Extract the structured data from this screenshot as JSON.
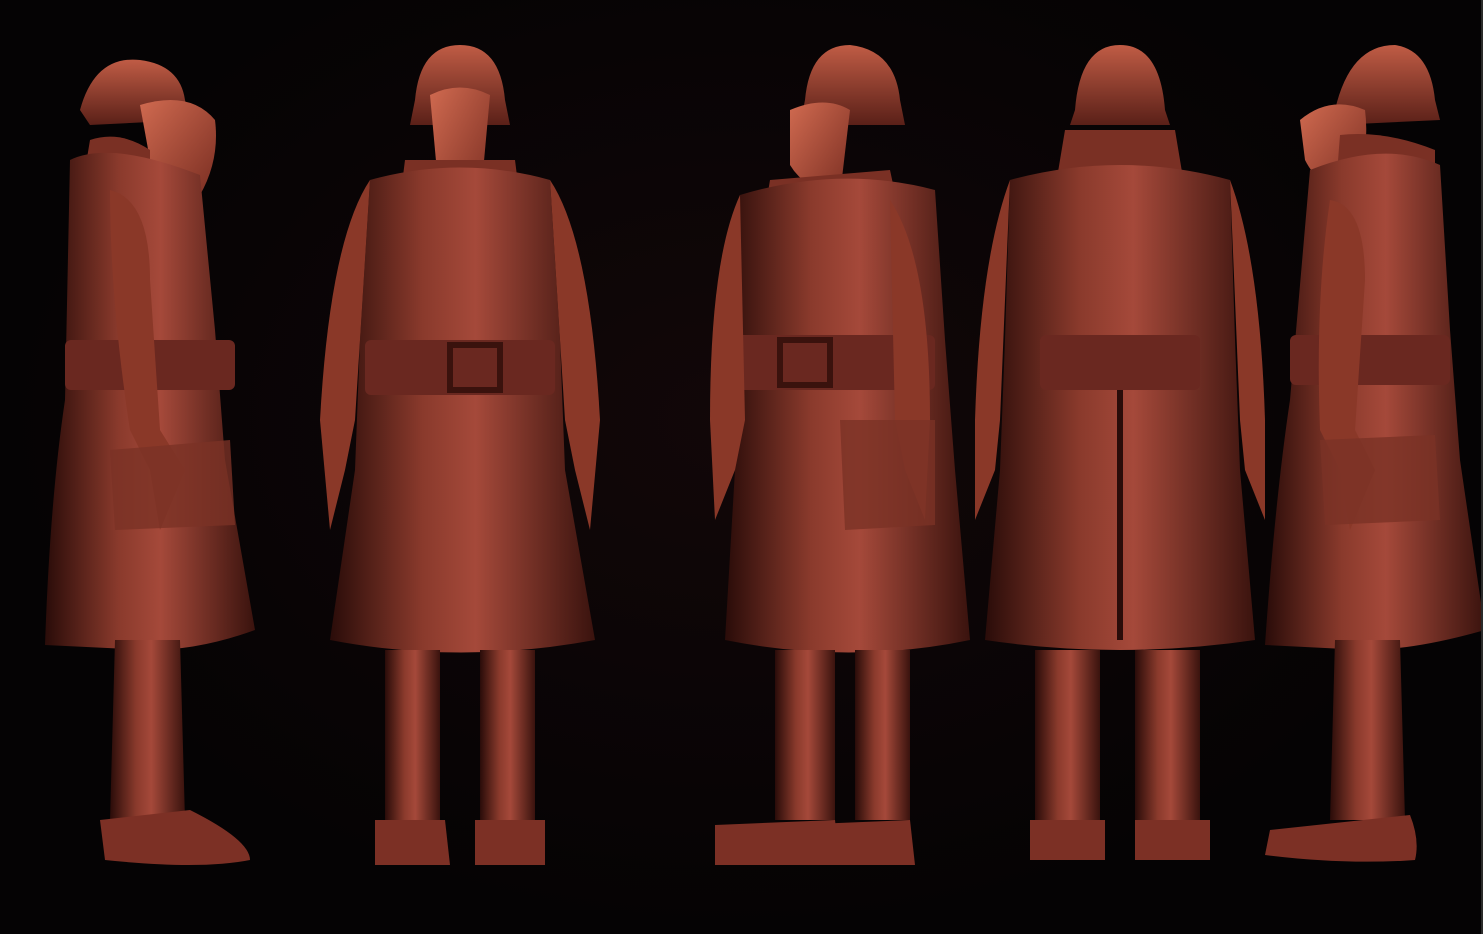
{
  "colors": {
    "background": "#050304",
    "clay_base": "#6e2c22",
    "clay_light": "#b0503c",
    "clay_dark": "#2a0c09",
    "clay_highlight": "#c9654d"
  },
  "views": [
    {
      "name": "side-left",
      "pose": "side",
      "facing": "left"
    },
    {
      "name": "front",
      "pose": "front",
      "facing": "front"
    },
    {
      "name": "three-quarter",
      "pose": "three-quarter",
      "facing": "left"
    },
    {
      "name": "back",
      "pose": "back",
      "facing": "back"
    },
    {
      "name": "side-left-2",
      "pose": "side",
      "facing": "left"
    }
  ]
}
